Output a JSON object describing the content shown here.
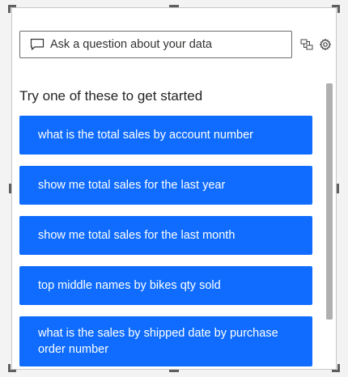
{
  "qna": {
    "input_placeholder": "Ask a question about your data",
    "heading": "Try one of these to get started",
    "suggestions": [
      "what is the total sales by account number",
      "show me total sales for the last year",
      "show me total sales for the last month",
      "top middle names by bikes qty sold",
      "what is the sales by shipped date by purchase order number"
    ]
  },
  "icons": {
    "input": "chat-bubble-icon",
    "switch": "switch-visual-icon",
    "settings": "gear-icon"
  },
  "colors": {
    "suggestion_bg": "#0f6cff",
    "suggestion_text": "#ffffff",
    "scrollbar": "#b0b0b0"
  }
}
